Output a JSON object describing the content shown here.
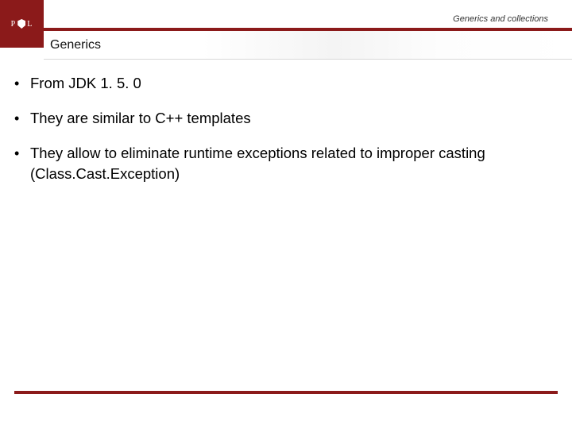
{
  "header": {
    "breadcrumb": "Generics and collections",
    "title": "Generics",
    "logo_letters_left": "P",
    "logo_letters_right": "L"
  },
  "content": {
    "bullets": [
      {
        "text": "From JDK 1. 5. 0"
      },
      {
        "text": "They are similar to C++ templates"
      },
      {
        "text": "They allow to eliminate runtime exceptions related to improper casting (Class.Cast.Exception)"
      }
    ]
  },
  "colors": {
    "accent": "#8b1a1a"
  }
}
